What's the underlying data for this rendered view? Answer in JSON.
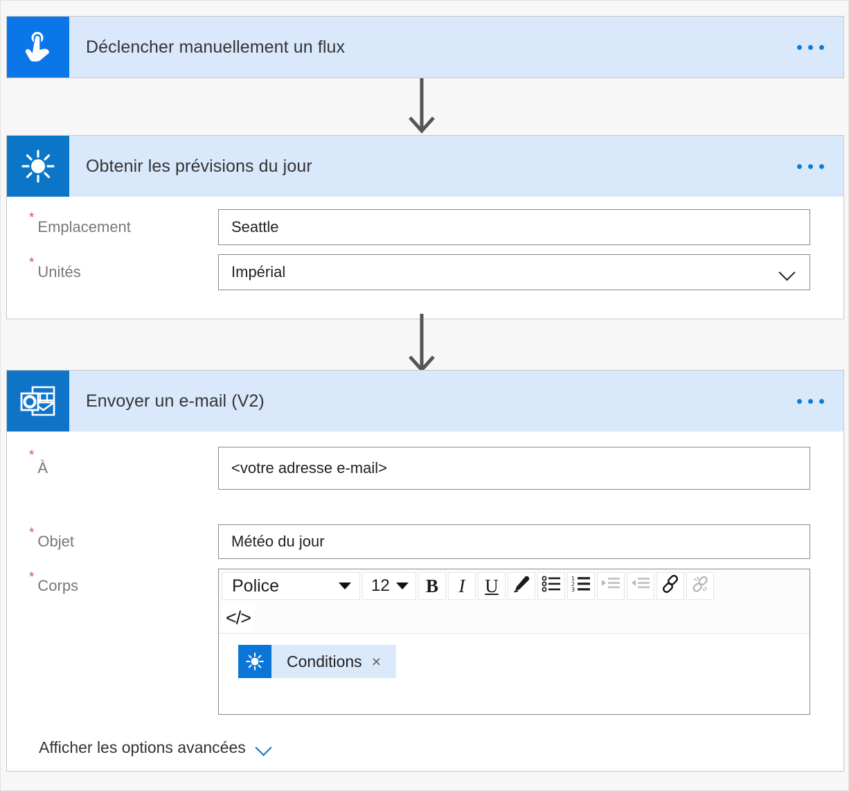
{
  "flow": {
    "steps": [
      {
        "id": "trigger",
        "title": "Déclencher manuellement un flux",
        "icon": "tap-hand-icon",
        "icon_bg": "#0b76e8",
        "menu_label": "...",
        "fields": []
      },
      {
        "id": "weather",
        "title": "Obtenir les prévisions du jour",
        "icon": "sun-weather-icon",
        "icon_bg": "#0b76c8",
        "menu_label": "...",
        "fields": [
          {
            "label": "Emplacement",
            "required": true,
            "required_marker": "*",
            "type": "text",
            "value": "Seattle"
          },
          {
            "label": "Unités",
            "required": true,
            "required_marker": "*",
            "type": "select",
            "value": "Impérial"
          }
        ]
      },
      {
        "id": "email",
        "title": "Envoyer un e-mail (V2)",
        "icon": "outlook-icon",
        "icon_bg": "#0f74c8",
        "menu_label": "...",
        "fields": [
          {
            "label": "À",
            "required": true,
            "required_marker": "*",
            "type": "text",
            "value": "<votre adresse e-mail>"
          },
          {
            "label": "Objet",
            "required": true,
            "required_marker": "*",
            "type": "text",
            "value": "Météo du jour"
          },
          {
            "label": "Corps",
            "required": true,
            "required_marker": "*",
            "type": "richtext"
          }
        ]
      }
    ]
  },
  "editor": {
    "toolbar": {
      "font_name": "Police",
      "font_size": "12",
      "bold": "B",
      "italic": "I",
      "underline": "U",
      "font_color": "pen-icon",
      "bulleted_list": "bulleted-list-icon",
      "numbered_list": "numbered-list-icon",
      "indent_increase": "indent-increase-icon",
      "indent_decrease": "indent-decrease-icon",
      "insert_link": "link-icon",
      "remove_link": "unlink-icon",
      "code_view": "</>"
    },
    "body_token": {
      "label": "Conditions",
      "icon": "sun-weather-icon",
      "remove": "×",
      "icon_bg": "#0b76d8",
      "chip_bg": "#dbeafb"
    }
  },
  "advanced": {
    "label": "Afficher les options avancées",
    "chevron": "chevron-down-icon"
  },
  "theme": {
    "header_bg": "#d9e9fb",
    "card_border": "#c8c8c8",
    "canvas_bg": "#f7f7f7",
    "required_red": "#e04b3c",
    "accent_blue": "#0f7cd8",
    "arrow_gray": "#555555"
  }
}
